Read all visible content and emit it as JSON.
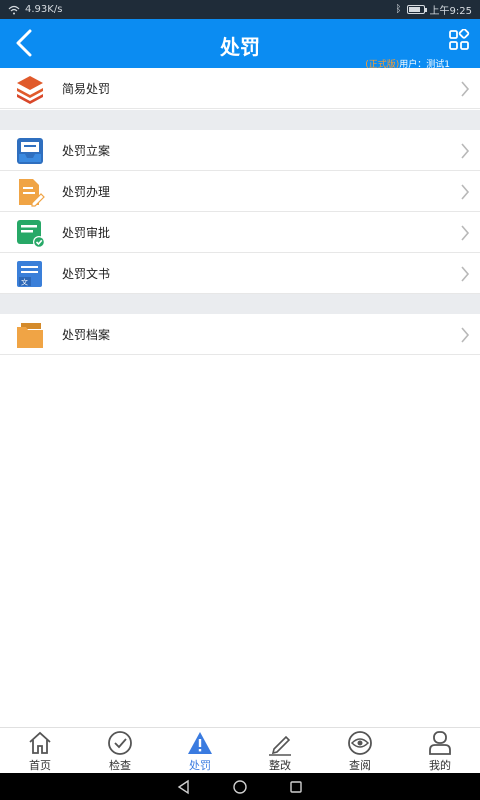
{
  "status_bar": {
    "network_speed": "4.93K/s",
    "time": "上午9:25",
    "battery_level": 0.75
  },
  "header": {
    "title": "处罚",
    "user_tag": "(正式版)",
    "user_label": "用户：测试1"
  },
  "menu_sections": [
    {
      "items": [
        {
          "label": "简易处罚",
          "icon": "layers-icon"
        }
      ]
    },
    {
      "items": [
        {
          "label": "处罚立案",
          "icon": "inbox-icon"
        },
        {
          "label": "处罚办理",
          "icon": "document-edit-icon"
        },
        {
          "label": "处罚审批",
          "icon": "approval-icon"
        },
        {
          "label": "处罚文书",
          "icon": "document-text-icon"
        }
      ]
    },
    {
      "items": [
        {
          "label": "处罚档案",
          "icon": "folder-icon"
        }
      ]
    }
  ],
  "bottom_nav": {
    "items": [
      {
        "label": "首页",
        "icon": "home-icon"
      },
      {
        "label": "检查",
        "icon": "check-circle-icon"
      },
      {
        "label": "处罚",
        "icon": "warning-icon",
        "active": true
      },
      {
        "label": "整改",
        "icon": "pencil-icon"
      },
      {
        "label": "查阅",
        "icon": "eye-icon"
      },
      {
        "label": "我的",
        "icon": "user-icon"
      }
    ]
  },
  "colors": {
    "header_bg": "#0b8cf2",
    "accent": "#3a7be0",
    "user_tag": "#ff9c2a"
  }
}
